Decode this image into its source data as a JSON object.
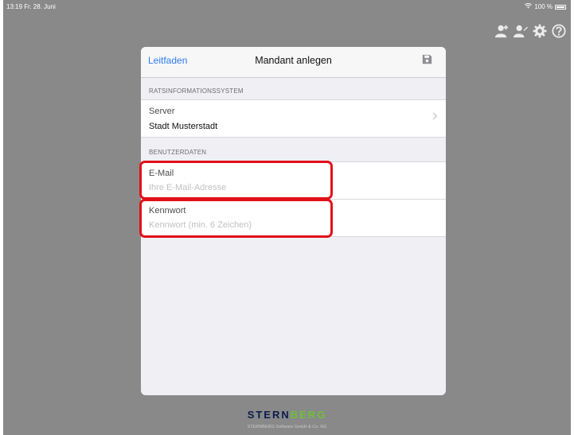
{
  "statusbar": {
    "time": "13:19  Fr. 28. Juni",
    "battery": "100 %",
    "icons": [
      "wifi-icon",
      "battery-icon"
    ]
  },
  "toolbar_icons": [
    "user-add-icon",
    "user-edit-icon",
    "gear-icon",
    "help-icon"
  ],
  "modal": {
    "nav": {
      "left_label": "Leitfaden",
      "title": "Mandant anlegen",
      "right_icon": "save-icon"
    },
    "sections": {
      "system": {
        "header": "RATSINFORMATIONSSYSTEM",
        "server_label": "Server",
        "server_value": "Stadt Musterstadt"
      },
      "user": {
        "header": "BENUTZERDATEN",
        "email_label": "E-Mail",
        "email_value": "",
        "email_placeholder": "Ihre E-Mail-Adresse",
        "password_label": "Kennwort",
        "password_value": "",
        "password_placeholder": "Kennwort (min. 6 Zeichen)"
      }
    }
  },
  "footer": {
    "logo_part1": "STERN",
    "logo_part2": "BERG",
    "subtitle": "STERNBERG Software GmbH & Co. KG"
  },
  "colors": {
    "accent": "#2f7bf6",
    "highlight": "#e11019",
    "logo_dark": "#0d1c4b",
    "logo_green": "#6fbf3a",
    "background": "#898989"
  }
}
